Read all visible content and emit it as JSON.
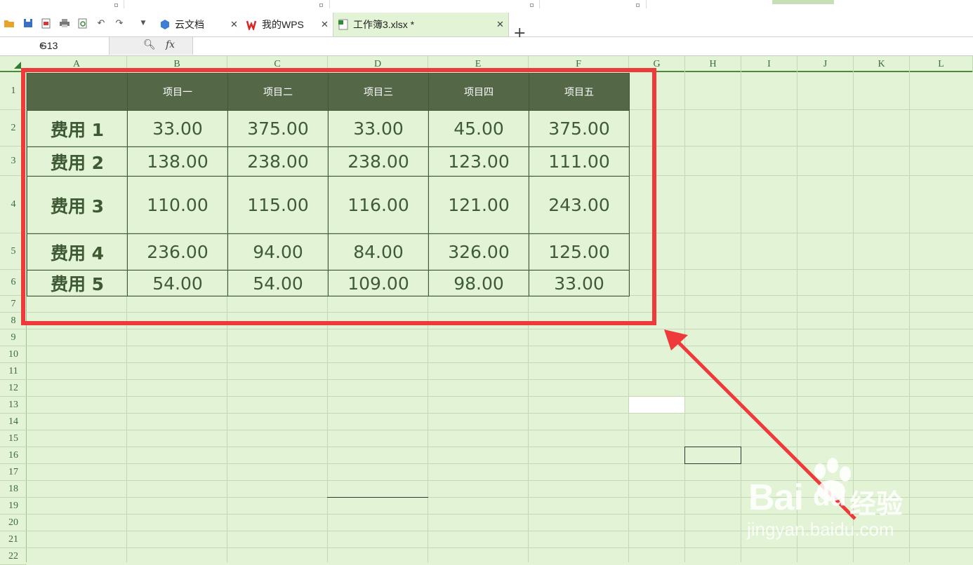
{
  "tabs": {
    "cloud_docs": "云文档",
    "my_wps": "我的WPS",
    "workbook": "工作簿3.xlsx *"
  },
  "formula_bar": {
    "cell_ref": "G13",
    "fx_label": "fx"
  },
  "columns": [
    "A",
    "B",
    "C",
    "D",
    "E",
    "F",
    "G",
    "H",
    "I",
    "J",
    "K",
    "L"
  ],
  "rows": [
    "1",
    "2",
    "3",
    "4",
    "5",
    "6",
    "7",
    "8",
    "9",
    "10",
    "11",
    "12",
    "13",
    "14",
    "15",
    "16",
    "17",
    "18",
    "19",
    "20",
    "21",
    "22"
  ],
  "table": {
    "header": [
      "",
      "项目一",
      "项目二",
      "项目三",
      "项目四",
      "项目五"
    ],
    "rows": [
      {
        "label": "费用 1",
        "values": [
          "33.00",
          "375.00",
          "33.00",
          "45.00",
          "375.00"
        ]
      },
      {
        "label": "费用 2",
        "values": [
          "138.00",
          "238.00",
          "238.00",
          "123.00",
          "111.00"
        ]
      },
      {
        "label": "费用 3",
        "values": [
          "110.00",
          "115.00",
          "116.00",
          "121.00",
          "243.00"
        ]
      },
      {
        "label": "费用 4",
        "values": [
          "236.00",
          "94.00",
          "84.00",
          "326.00",
          "125.00"
        ]
      },
      {
        "label": "费用 5",
        "values": [
          "54.00",
          "54.00",
          "109.00",
          "98.00",
          "33.00"
        ]
      }
    ]
  },
  "watermark": {
    "brand": "Bai",
    "brand_suffix": "du",
    "product": "经验",
    "url": "jingyan.baidu.com"
  },
  "colors": {
    "sheet_bg": "#e3f3d6",
    "header_fill": "#546848",
    "highlight_red": "#ee3a3a"
  }
}
